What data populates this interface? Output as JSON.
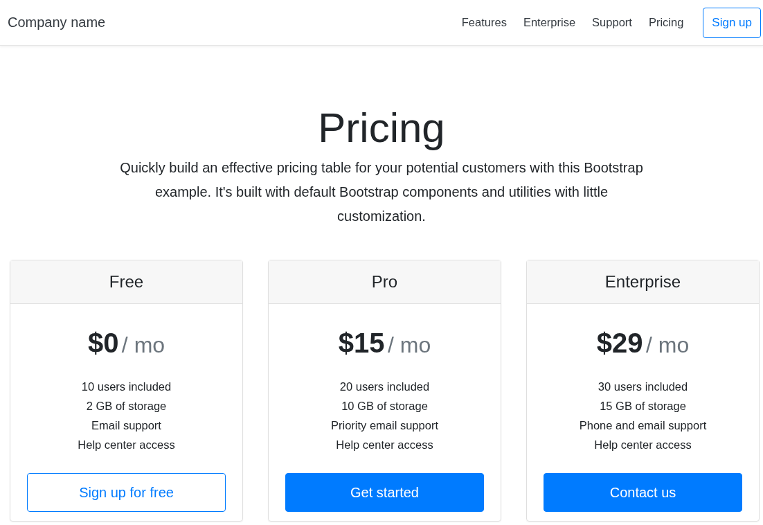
{
  "navbar": {
    "brand": "Company name",
    "links": [
      "Features",
      "Enterprise",
      "Support",
      "Pricing"
    ],
    "button": "Sign up"
  },
  "hero": {
    "title": "Pricing",
    "lead": "Quickly build an effective pricing table for your potential customers with this Bootstrap example. It's built with default Bootstrap components and utilities with little customization."
  },
  "plans": [
    {
      "name": "Free",
      "price": "$0",
      "period": "/ mo",
      "features": [
        "10 users included",
        "2 GB of storage",
        "Email support",
        "Help center access"
      ],
      "button": {
        "label": "Sign up for free",
        "kind": "outline"
      }
    },
    {
      "name": "Pro",
      "price": "$15",
      "period": "/ mo",
      "features": [
        "20 users included",
        "10 GB of storage",
        "Priority email support",
        "Help center access"
      ],
      "button": {
        "label": "Get started",
        "kind": "solid"
      }
    },
    {
      "name": "Enterprise",
      "price": "$29",
      "period": "/ mo",
      "features": [
        "30 users included",
        "15 GB of storage",
        "Phone and email support",
        "Help center access"
      ],
      "button": {
        "label": "Contact us",
        "kind": "solid"
      }
    }
  ]
}
